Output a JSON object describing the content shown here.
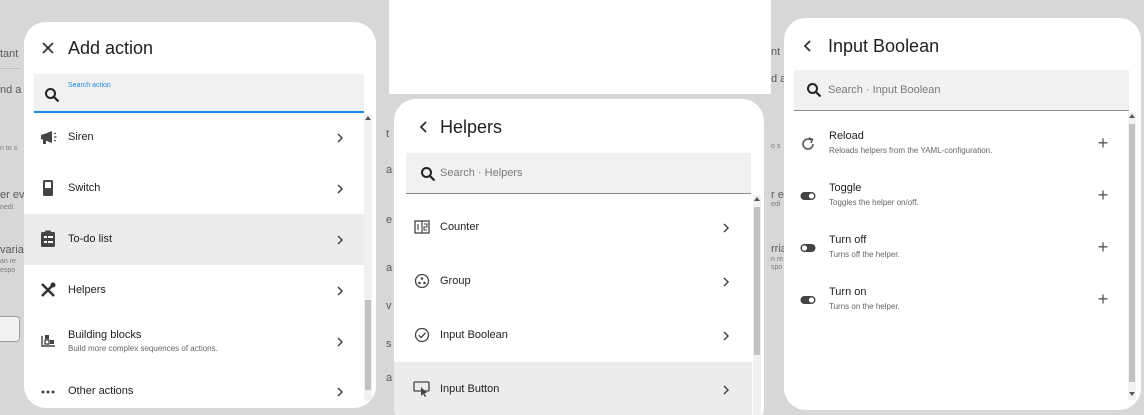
{
  "panel1": {
    "background_fragments": [
      "tant",
      "nd a",
      "n to s",
      "er ev",
      "nedi",
      "varia",
      "an re",
      "espo"
    ],
    "dialog": {
      "title": "Add action",
      "close_icon": "close-icon",
      "search": {
        "placeholder": "Search action",
        "focused": true
      },
      "items": [
        {
          "icon": "siren-icon",
          "label": "Siren",
          "subtitle": ""
        },
        {
          "icon": "switch-icon",
          "label": "Switch",
          "subtitle": ""
        },
        {
          "icon": "todo-list-icon",
          "label": "To-do list",
          "subtitle": "",
          "highlighted": true
        },
        {
          "icon": "helpers-icon",
          "label": "Helpers",
          "subtitle": ""
        },
        {
          "icon": "building-blocks-icon",
          "label": "Building blocks",
          "subtitle": "Build more complex sequences of actions."
        },
        {
          "icon": "more-icon",
          "label": "Other actions",
          "subtitle": ""
        }
      ]
    }
  },
  "panel2": {
    "background_fragments": [
      "t",
      "a",
      "e",
      "a",
      "v",
      "s",
      "a"
    ],
    "dialog": {
      "title": "Helpers",
      "back_icon": "back-icon",
      "search": {
        "placeholder": "Search · Helpers"
      },
      "items": [
        {
          "icon": "counter-icon",
          "label": "Counter"
        },
        {
          "icon": "group-icon",
          "label": "Group"
        },
        {
          "icon": "input-boolean-icon",
          "label": "Input Boolean"
        },
        {
          "icon": "input-button-icon",
          "label": "Input Button",
          "highlighted": true
        }
      ]
    }
  },
  "panel3": {
    "background_fragments": [
      "nt",
      "d a",
      "o s",
      "r ev",
      "edi",
      "rria",
      "n re",
      "spo"
    ],
    "dialog": {
      "title": "Input Boolean",
      "back_icon": "back-icon",
      "search": {
        "placeholder": "Search · Input Boolean"
      },
      "items": [
        {
          "icon": "reload-icon",
          "label": "Reload",
          "subtitle": "Reloads helpers from the YAML-configuration."
        },
        {
          "icon": "toggle-icon",
          "label": "Toggle",
          "subtitle": "Toggles the helper on/off."
        },
        {
          "icon": "toggle-off-icon",
          "label": "Turn off",
          "subtitle": "Turns off the helper."
        },
        {
          "icon": "toggle-on-icon",
          "label": "Turn on",
          "subtitle": "Turns on the helper."
        }
      ]
    }
  }
}
